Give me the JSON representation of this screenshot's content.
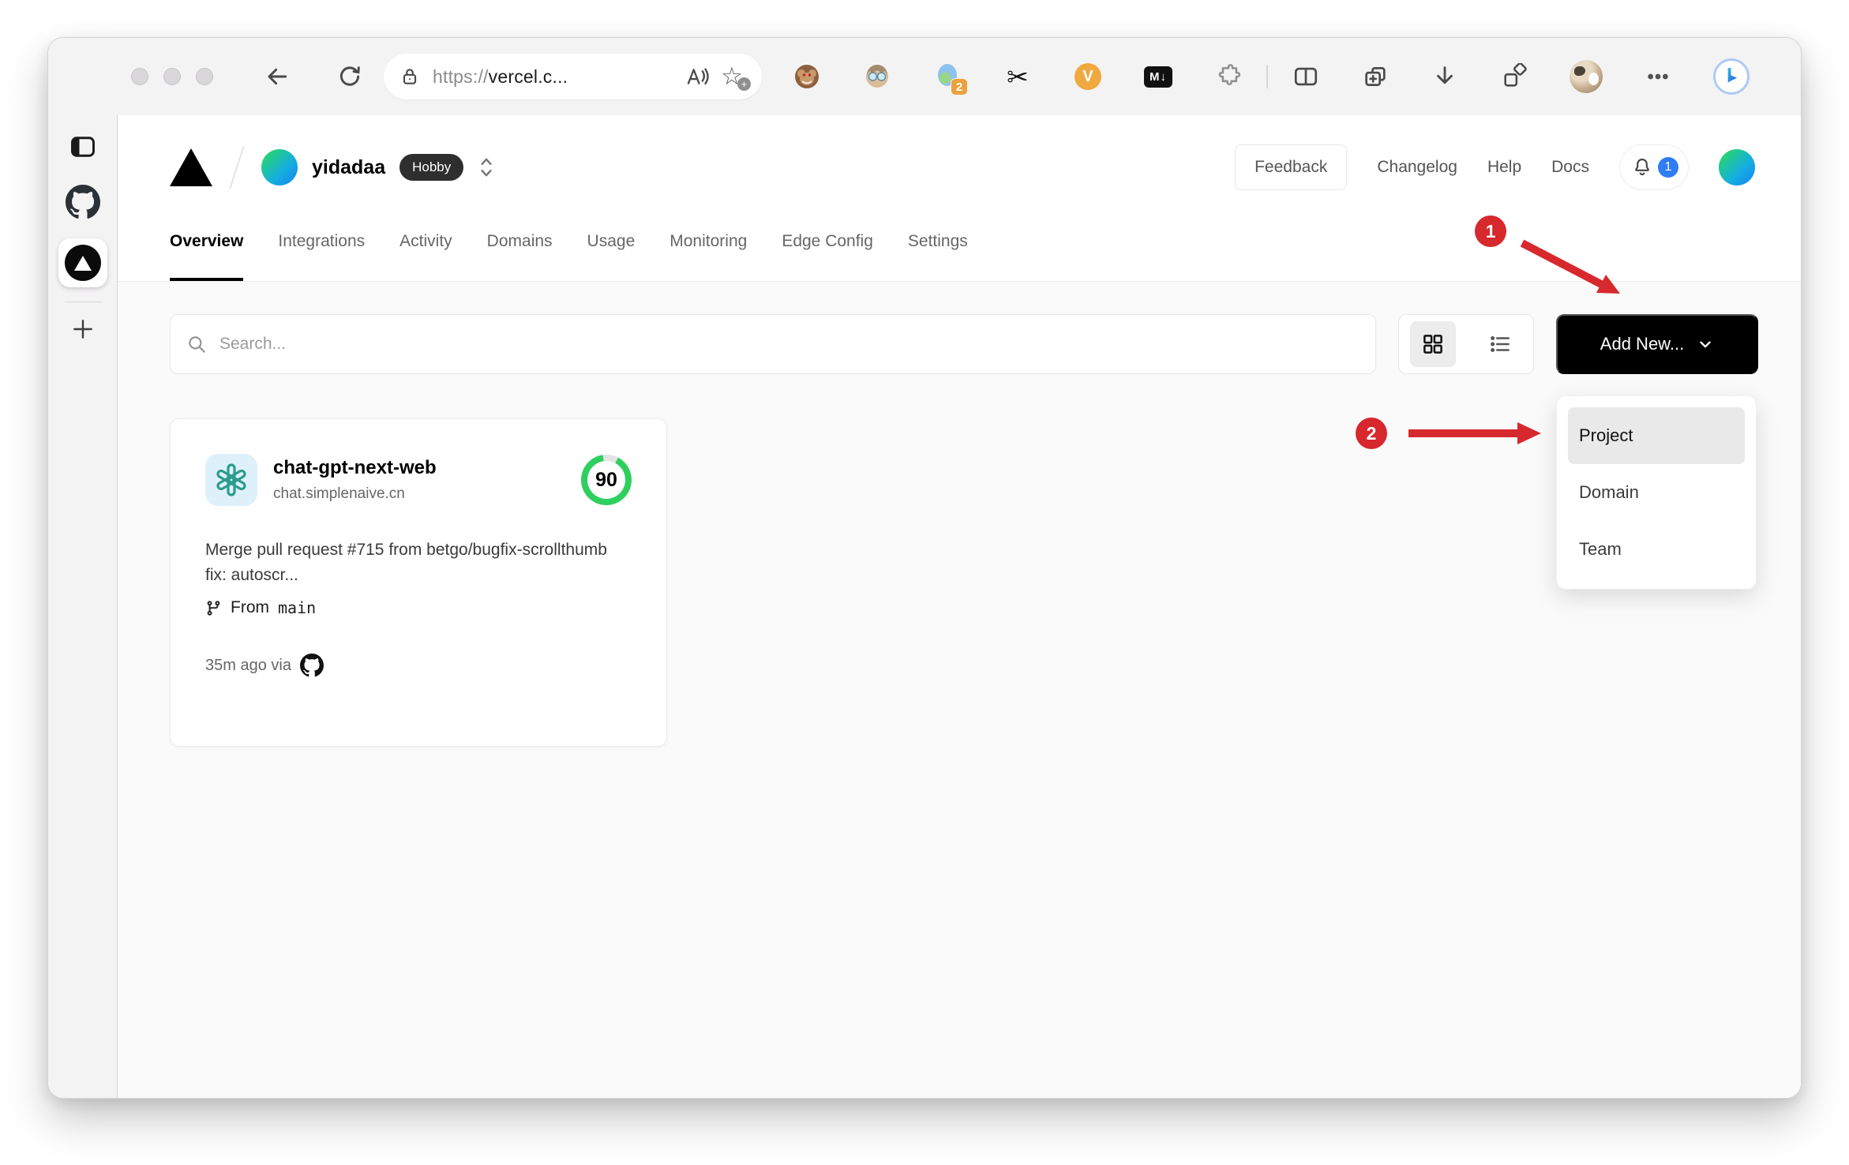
{
  "browser": {
    "url_scheme": "https://",
    "url_host": "vercel.c...",
    "extensions": {
      "scissors_glyph": "✂",
      "markdown_label": "M↓",
      "v_label": "V",
      "translate_badge": "2"
    }
  },
  "header": {
    "team_name": "yidadaa",
    "plan_badge": "Hobby",
    "feedback_label": "Feedback",
    "links": [
      {
        "label": "Changelog"
      },
      {
        "label": "Help"
      },
      {
        "label": "Docs"
      }
    ],
    "notification_count": "1"
  },
  "tabs": [
    {
      "label": "Overview",
      "active": true
    },
    {
      "label": "Integrations"
    },
    {
      "label": "Activity"
    },
    {
      "label": "Domains"
    },
    {
      "label": "Usage"
    },
    {
      "label": "Monitoring"
    },
    {
      "label": "Edge Config"
    },
    {
      "label": "Settings"
    }
  ],
  "toolbar": {
    "search_placeholder": "Search...",
    "add_new_label": "Add New..."
  },
  "dropdown": {
    "items": [
      {
        "label": "Project",
        "highlighted": true
      },
      {
        "label": "Domain"
      },
      {
        "label": "Team"
      }
    ]
  },
  "project_card": {
    "name": "chat-gpt-next-web",
    "domain": "chat.simplenaive.cn",
    "score": "90",
    "commit_message": "Merge pull request #715 from betgo/bugfix-scrollthumb fix: autoscr...",
    "branch_prefix": "From",
    "branch_name": "main",
    "deploy_meta": "35m ago via"
  },
  "annotations": {
    "step1": "1",
    "step2": "2"
  },
  "colors": {
    "annotation_red": "#d7282d",
    "score_green": "#2ecf5d",
    "notification_blue": "#2f7cf6",
    "add_new_black": "#000000"
  }
}
